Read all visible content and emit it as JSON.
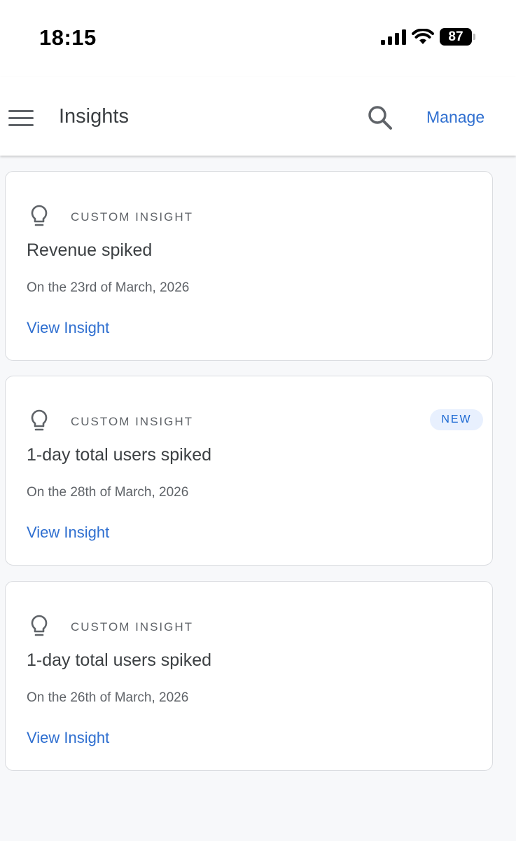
{
  "status_bar": {
    "time": "18:15",
    "battery": "87",
    "icons": [
      "cellular-signal-icon",
      "wifi-icon",
      "battery-icon"
    ]
  },
  "app_bar": {
    "title": "Insights",
    "manage_label": "Manage",
    "icons": [
      "menu-icon",
      "search-icon"
    ]
  },
  "cards": [
    {
      "icon": "lightbulb-icon",
      "category": "CUSTOM INSIGHT",
      "badge": "",
      "title": "Revenue spiked",
      "date": "On the 23rd of March, 2026",
      "link_label": "View Insight"
    },
    {
      "icon": "lightbulb-icon",
      "category": "CUSTOM INSIGHT",
      "badge": "NEW",
      "title": "1-day total users spiked",
      "date": "On the 28th of March, 2026",
      "link_label": "View Insight"
    },
    {
      "icon": "lightbulb-icon",
      "category": "CUSTOM INSIGHT",
      "badge": "",
      "title": "1-day total users spiked",
      "date": "On the 26th of March, 2026",
      "link_label": "View Insight"
    }
  ],
  "colors": {
    "accent": "#2f6fd0",
    "badge_background": "#e8f0fe",
    "page_background": "#f7f8fa",
    "card_border": "#dadce0"
  }
}
